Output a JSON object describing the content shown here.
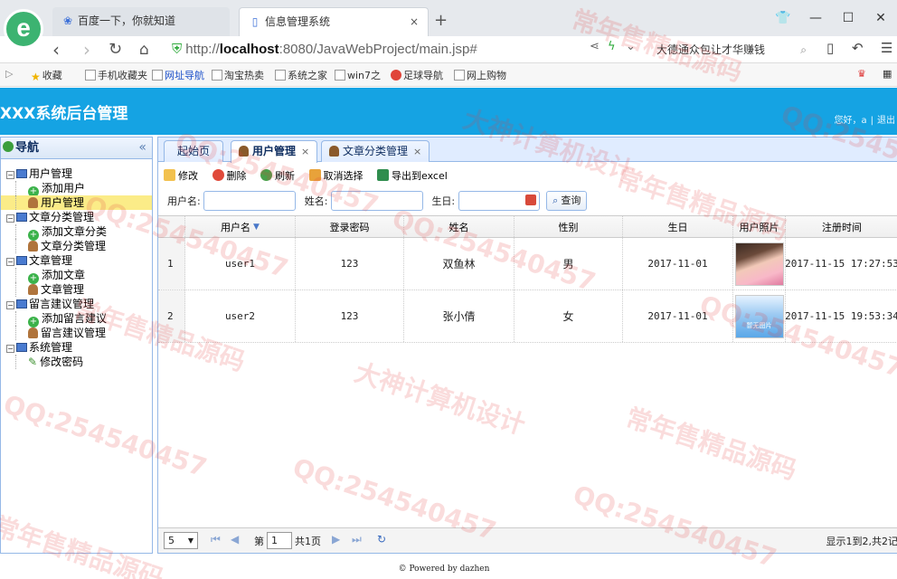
{
  "browser": {
    "logo_letter": "e",
    "tabs": [
      {
        "title": "百度一下，你就知道",
        "icon": "baidu-paw-icon"
      },
      {
        "title": "信息管理系统",
        "icon": "page-icon",
        "close": "×"
      }
    ],
    "new_tab": "+",
    "window_controls": {
      "shirt": "👕",
      "minimize": "—",
      "maximize": "☐",
      "close": "✕"
    },
    "address": {
      "scheme": "http://",
      "host": "localhost",
      "path": ":8080/JavaWebProject/main.jsp#"
    },
    "search_text": "大德通众包让才华赚钱",
    "bookmarks": [
      "收藏",
      "手机收藏夹",
      "网址导航",
      "淘宝热卖",
      "系统之家",
      "win7之",
      "足球导航",
      "网上购物"
    ]
  },
  "app": {
    "title": "XXX系统后台管理",
    "greeting": "您好，a",
    "separator": "|",
    "logout": "退出"
  },
  "sidebar": {
    "title": "导航",
    "collapse": "«",
    "tree": [
      {
        "label": "用户管理",
        "level": 0
      },
      {
        "label": "添加用户",
        "level": 1,
        "icon": "add"
      },
      {
        "label": "用户管理",
        "level": 1,
        "icon": "user",
        "selected": true
      },
      {
        "label": "文章分类管理",
        "level": 0
      },
      {
        "label": "添加文章分类",
        "level": 1,
        "icon": "add"
      },
      {
        "label": "文章分类管理",
        "level": 1,
        "icon": "user"
      },
      {
        "label": "文章管理",
        "level": 0
      },
      {
        "label": "添加文章",
        "level": 1,
        "icon": "add"
      },
      {
        "label": "文章管理",
        "level": 1,
        "icon": "user"
      },
      {
        "label": "留言建议管理",
        "level": 0
      },
      {
        "label": "添加留言建议",
        "level": 1,
        "icon": "add"
      },
      {
        "label": "留言建议管理",
        "level": 1,
        "icon": "user"
      },
      {
        "label": "系统管理",
        "level": 0
      },
      {
        "label": "修改密码",
        "level": 1,
        "icon": "pencil"
      }
    ]
  },
  "main": {
    "tabs": [
      {
        "label": "起始页"
      },
      {
        "label": "用户管理",
        "active": true,
        "close": "×"
      },
      {
        "label": "文章分类管理",
        "close": "×"
      }
    ],
    "toolbar": {
      "edit": "修改",
      "delete": "删除",
      "refresh": "刷新",
      "cancel_select": "取消选择",
      "export": "导出到excel"
    },
    "search": {
      "username_label": "用户名:",
      "name_label": "姓名:",
      "birthday_label": "生日:",
      "query_button": "查询",
      "username_value": "",
      "name_value": "",
      "birthday_value": ""
    },
    "grid": {
      "columns": [
        "用户名",
        "登录密码",
        "姓名",
        "性别",
        "生日",
        "用户照片",
        "注册时间"
      ],
      "rows": [
        {
          "num": "1",
          "username": "user1",
          "password": "123",
          "name": "双鱼林",
          "gender": "男",
          "birthday": "2017-11-01",
          "photo_caption": "",
          "regtime": "2017-11-15 17:27:53"
        },
        {
          "num": "2",
          "username": "user2",
          "password": "123",
          "name": "张小倩",
          "gender": "女",
          "birthday": "2017-11-01",
          "photo_caption": "暂无图片",
          "regtime": "2017-11-15 19:53:34"
        }
      ]
    },
    "pager": {
      "page_size": "5",
      "page_prefix": "第",
      "page_number": "1",
      "page_suffix": "共1页",
      "info": "显示1到2,共2记"
    }
  },
  "footer": "© Powered by dazhen",
  "watermarks": {
    "qq": "QQ:254540457",
    "brand1": "大神计算机设计",
    "brand2": "常年售精品源码"
  }
}
